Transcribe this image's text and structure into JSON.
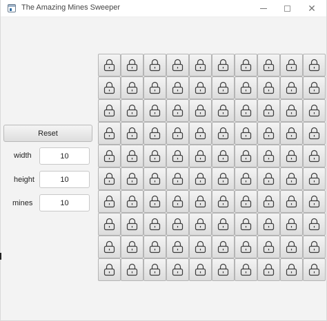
{
  "window": {
    "title": "The Amazing Mines Sweeper"
  },
  "controls": {
    "reset_label": "Reset",
    "fields": [
      {
        "label": "width",
        "value": "10"
      },
      {
        "label": "height",
        "value": "10"
      },
      {
        "label": "mines",
        "value": "10"
      }
    ]
  },
  "board": {
    "columns": 10,
    "rows": 10,
    "cell_icon": "lock-icon",
    "colors": {
      "cell_top": "#f4f4f4",
      "cell_bottom": "#dcdcdc",
      "cell_border": "#b4b4b4",
      "icon_stroke": "#3a3a3a"
    }
  }
}
